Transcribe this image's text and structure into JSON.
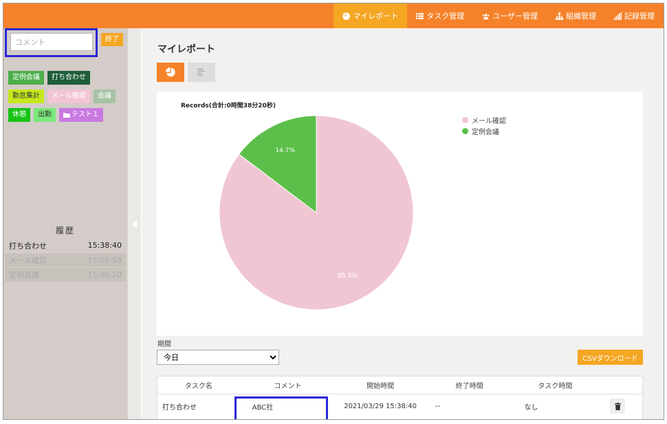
{
  "nav": {
    "items": [
      {
        "label": "マイレポート",
        "icon": "pie-chart-icon",
        "active": true
      },
      {
        "label": "タスク管理",
        "icon": "list-icon",
        "active": false
      },
      {
        "label": "ユーザー管理",
        "icon": "users-icon",
        "active": false
      },
      {
        "label": "組織管理",
        "icon": "sitemap-icon",
        "active": false
      },
      {
        "label": "記録管理",
        "icon": "signal-bars-icon",
        "active": false
      }
    ]
  },
  "sidebar": {
    "comment_placeholder": "コメント",
    "end_label": "終了",
    "tags": [
      [
        {
          "label": "定例会議",
          "color": "#4cae4c"
        },
        {
          "label": "打ち合わせ",
          "color": "#1e5e3a"
        }
      ],
      [
        {
          "label": "勤怠集計",
          "color": "#c6e81e",
          "text_color": "#333"
        },
        {
          "label": "メール確認",
          "color": "#f2c4d4"
        },
        {
          "label": "会議",
          "color": "#a7c2a4"
        }
      ],
      [
        {
          "label": "休憩",
          "color": "#16c416"
        },
        {
          "label": "出勤",
          "color": "#7be87b",
          "text_color": "#333"
        },
        {
          "label": "テスト１",
          "color": "#c979e0",
          "icon": "folder-icon"
        }
      ]
    ],
    "history_title": "履歴",
    "history": [
      {
        "task": "打ち合わせ",
        "time": "15:38:40"
      },
      {
        "task": "メール確認",
        "time": "15:05:58"
      },
      {
        "task": "定例会議",
        "time": "15:00:20"
      }
    ]
  },
  "main": {
    "title": "マイレポート",
    "period_label": "期間",
    "period_value": "今日",
    "csv_label": "CSVダウンロード",
    "table": {
      "headers": [
        "タスク名",
        "コメント",
        "開始時間",
        "終了時間",
        "タスク時間",
        ""
      ],
      "rows": [
        {
          "task": "打ち合わせ",
          "comment": "ABC社",
          "start": "2021/03/29 15:38:40",
          "end": "--",
          "duration": "なし"
        }
      ]
    }
  },
  "chart_data": {
    "type": "pie",
    "title": "Records(合計:0時間38分20秒)",
    "slices": [
      {
        "label": "メール確認",
        "value": 85.3,
        "color": "#f0c6d3",
        "display": "85.3%"
      },
      {
        "label": "定例会議",
        "value": 14.7,
        "color": "#5cbf4a",
        "display": "14.7%"
      }
    ],
    "legend_position": "top-right"
  }
}
